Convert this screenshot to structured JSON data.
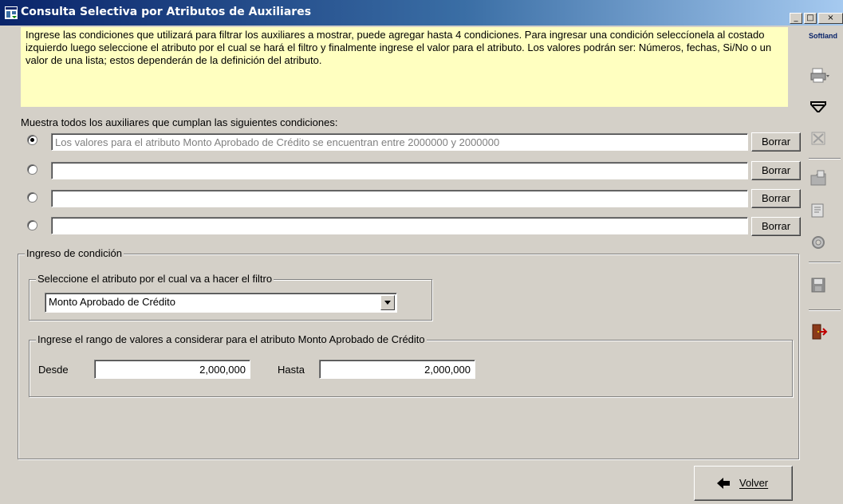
{
  "window": {
    "title": "Consulta Selectiva por Atributos de Auxiliares",
    "minimize_glyph": "_",
    "maximize_glyph": "□",
    "close_glyph": "×"
  },
  "info": {
    "text": "Ingrese las condiciones que utilizará para filtrar los auxiliares a mostrar, puede agregar hasta 4 condiciones. Para ingresar una condición seleccíonela al costado izquierdo luego seleccione el atributo por el cual se hará el filtro y finalmente ingrese el valor para el atributo. Los valores podrán ser: Números, fechas, Si/No o un valor de una lista; estos dependerán de la definición del atributo."
  },
  "conditions": {
    "label": "Muestra todos los auxiliares que cumplan las siguientes condiciones:",
    "rows": [
      {
        "value": "Los valores para el atributo Monto Aprobado de Crédito  se encuentran entre 2000000 y 2000000",
        "selected": true,
        "button": "Borrar"
      },
      {
        "value": "",
        "selected": false,
        "button": "Borrar"
      },
      {
        "value": "",
        "selected": false,
        "button": "Borrar"
      },
      {
        "value": "",
        "selected": false,
        "button": "Borrar"
      }
    ]
  },
  "ingreso": {
    "legend": "Ingreso de condición",
    "atributo": {
      "legend": "Seleccione el atributo por el cual va a hacer el filtro",
      "selected": "Monto Aprobado de Crédito"
    },
    "rango": {
      "legend": "Ingrese el rango de valores a considerar para el atributo Monto Aprobado de Crédito",
      "desde_label": "Desde",
      "desde_value": "2,000,000",
      "hasta_label": "Hasta",
      "hasta_value": "2,000,000"
    }
  },
  "footer": {
    "volver_label": "Volver"
  },
  "toolbar": {
    "brand": "Softland",
    "icons": [
      "printer-icon",
      "filter-icon",
      "excel-icon",
      "open-folder-icon",
      "properties-icon",
      "settings-icon",
      "save-icon",
      "exit-door-icon"
    ]
  }
}
